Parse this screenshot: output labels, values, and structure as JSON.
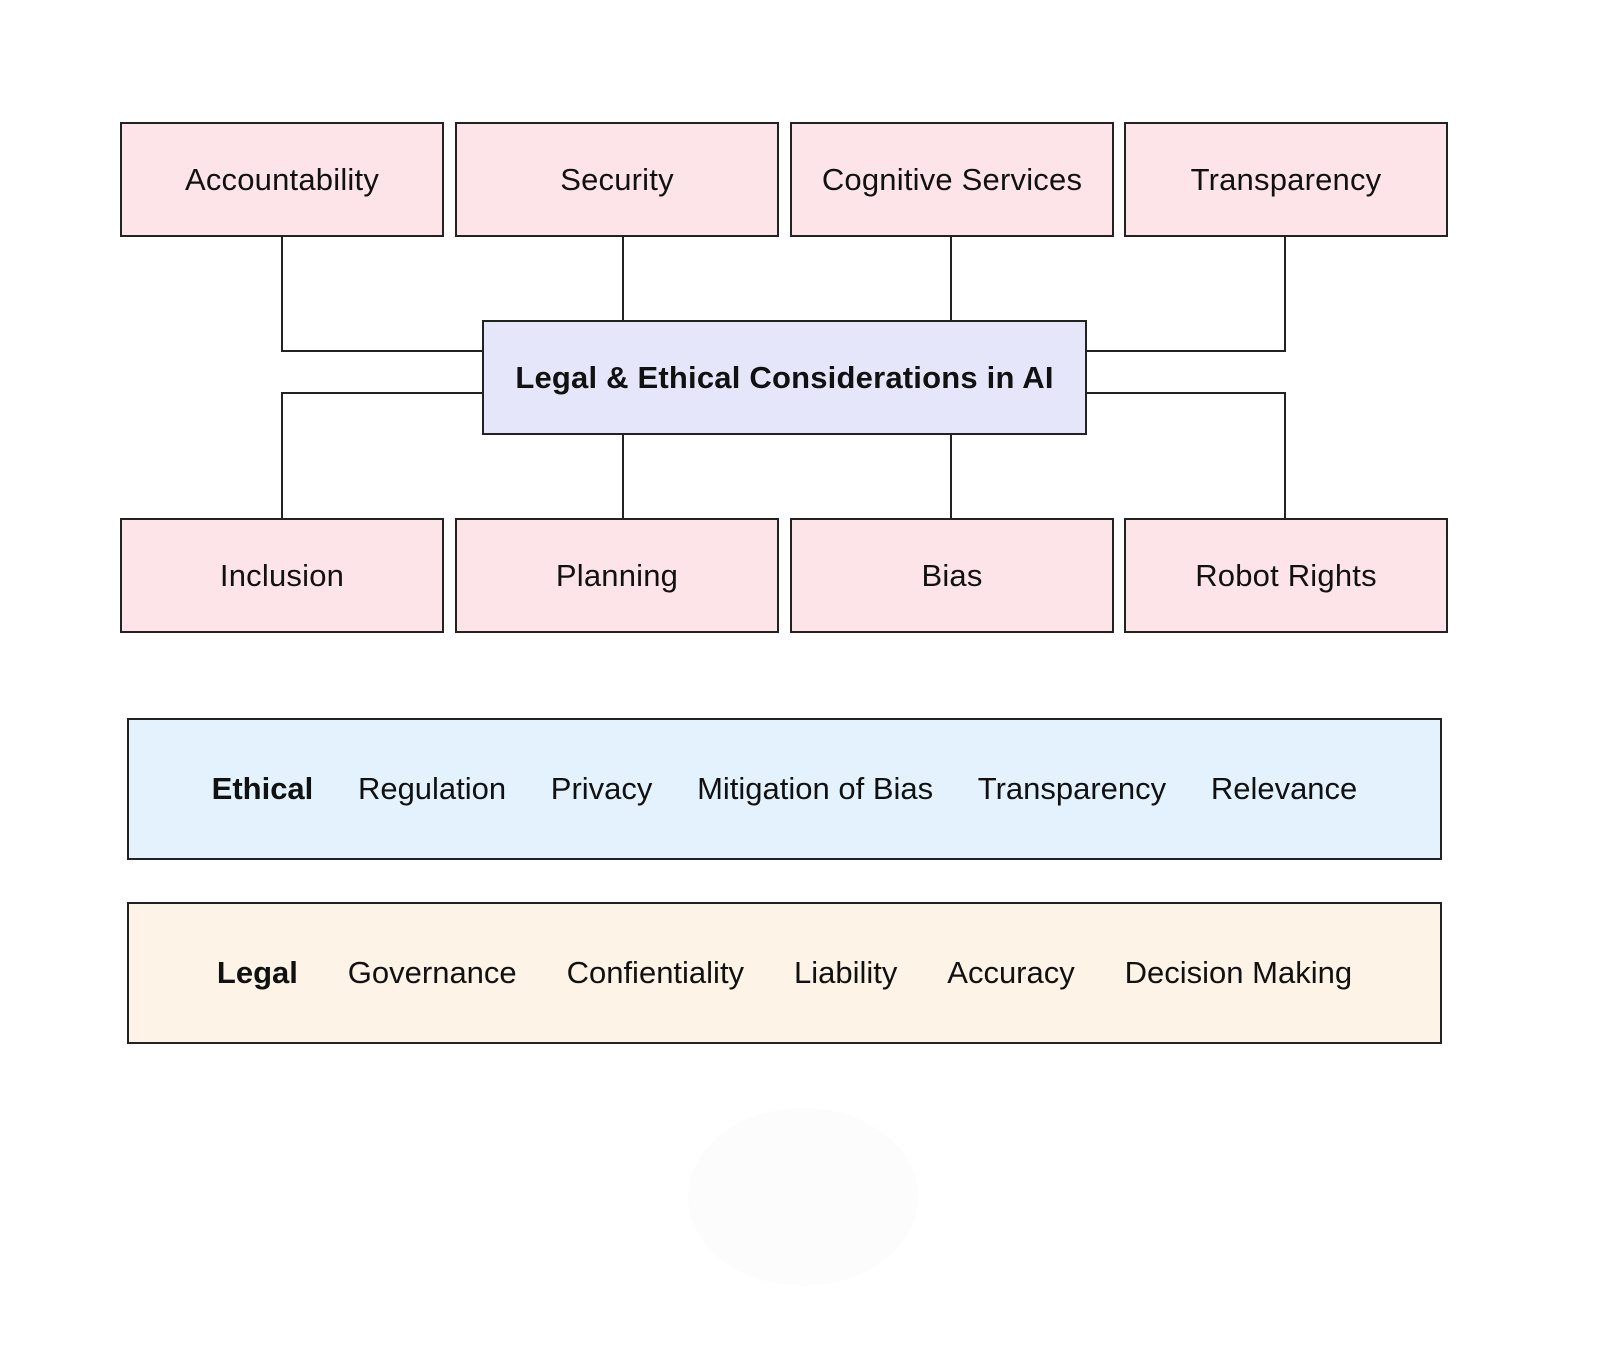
{
  "diagram": {
    "center": {
      "label": "Legal & Ethical Considerations in AI"
    },
    "top_nodes": [
      {
        "label": "Accountability"
      },
      {
        "label": "Security"
      },
      {
        "label": "Cognitive Services"
      },
      {
        "label": "Transparency"
      }
    ],
    "bottom_nodes": [
      {
        "label": "Inclusion"
      },
      {
        "label": "Planning"
      },
      {
        "label": "Bias"
      },
      {
        "label": "Robot Rights"
      }
    ],
    "edges": [
      {
        "from": "Legal & Ethical Considerations in AI",
        "to": "Accountability"
      },
      {
        "from": "Legal & Ethical Considerations in AI",
        "to": "Security"
      },
      {
        "from": "Legal & Ethical Considerations in AI",
        "to": "Cognitive Services"
      },
      {
        "from": "Legal & Ethical Considerations in AI",
        "to": "Transparency"
      },
      {
        "from": "Legal & Ethical Considerations in AI",
        "to": "Inclusion"
      },
      {
        "from": "Legal & Ethical Considerations in AI",
        "to": "Planning"
      },
      {
        "from": "Legal & Ethical Considerations in AI",
        "to": "Bias"
      },
      {
        "from": "Legal & Ethical Considerations in AI",
        "to": "Robot Rights"
      }
    ]
  },
  "bands": {
    "ethical": {
      "heading": "Ethical",
      "items": [
        "Regulation",
        "Privacy",
        "Mitigation of Bias",
        "Transparency",
        "Relevance"
      ]
    },
    "legal": {
      "heading": "Legal",
      "items": [
        "Governance",
        "Confientiality",
        "Liability",
        "Accuracy",
        "Decision Making"
      ]
    }
  },
  "colors": {
    "leaf_fill": "#fde4e8",
    "center_fill": "#e6e6fa",
    "ethical_fill": "#e3f2fd",
    "legal_fill": "#fdf3e6",
    "stroke": "#222222"
  }
}
